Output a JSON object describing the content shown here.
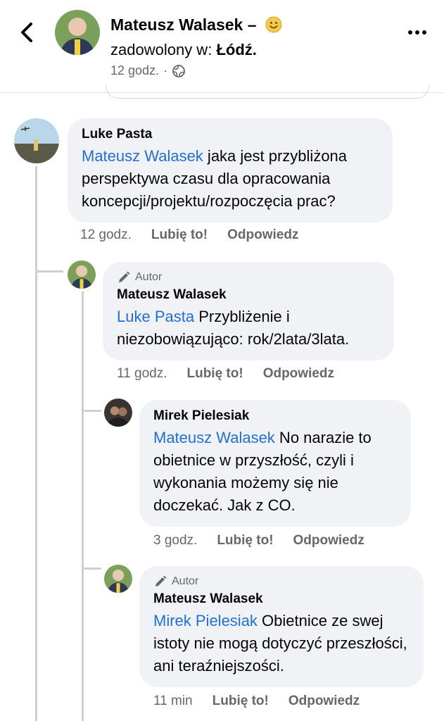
{
  "header": {
    "name": "Mateusz Walasek",
    "dash": "–",
    "feeling_prefix": "zadowolony w:",
    "location": "Łódź.",
    "time": "12 godz.",
    "dot": "·"
  },
  "comments": [
    {
      "author": "Luke Pasta",
      "mention": "Mateusz Walasek",
      "text": " jaka jest przybliżona perspektywa czasu dla opracowania koncepcji/projektu/rozpoczęcia prac?",
      "time": "12 godz.",
      "like": "Lubię to!",
      "reply": "Odpowiedz"
    },
    {
      "badge": "Autor",
      "author": "Mateusz Walasek",
      "mention": "Luke Pasta",
      "text": " Przybliżenie i niezobowiązująco: rok/2lata/3lata.",
      "time": "11 godz.",
      "like": "Lubię to!",
      "reply": "Odpowiedz"
    },
    {
      "author": "Mirek Pielesiak",
      "mention": "Mateusz Walasek",
      "text": " No narazie to obietnice w przyszłość, czyli i wykonania możemy się nie doczekać. Jak z CO.",
      "time": "3 godz.",
      "like": "Lubię to!",
      "reply": "Odpowiedz"
    },
    {
      "badge": "Autor",
      "author": "Mateusz Walasek",
      "mention": "Mirek Pielesiak",
      "text": " Obietnice ze swej istoty nie mogą dotyczyć przeszłości, ani teraźniejszości.",
      "time": "11 min",
      "like": "Lubię to!",
      "reply": "Odpowiedz"
    }
  ],
  "colors": {
    "mention": "#216fdb",
    "bubble": "#f0f2f5",
    "meta": "#65676b"
  },
  "icons": [
    "back-arrow-icon",
    "smile-emoji-icon",
    "globe-icon",
    "more-icon",
    "pencil-icon"
  ]
}
